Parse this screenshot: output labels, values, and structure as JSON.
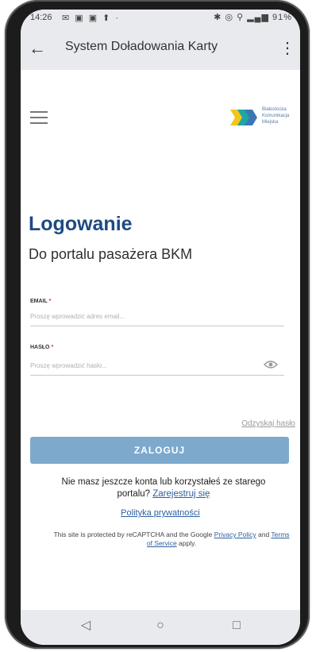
{
  "status_bar": {
    "time": "14:26",
    "left_icons": "✉ ▣ ▣ ⬆ ·",
    "right_icons": "✱ ◎ ⚲ ▂▄▆ 91%"
  },
  "app_bar": {
    "title": "System Doładowania Karty",
    "back_icon": "back-arrow-icon",
    "menu_icon": "kebab-menu-icon"
  },
  "header": {
    "menu_icon": "hamburger-menu-icon",
    "logo_text": [
      "Białostocka",
      "Komunikacja",
      "Miejska"
    ],
    "logo_colors": {
      "yellow": "#f2c51b",
      "blue": "#3c77b5",
      "teal": "#1fa6a4"
    }
  },
  "login": {
    "title": "Logowanie",
    "subtitle": "Do portalu pasażera BKM",
    "email_label": "EMAIL",
    "email_placeholder": "Proszę wprowadzić adres email...",
    "password_label": "HASŁO",
    "password_placeholder": "Proszę wprowadzić hasło...",
    "required_mark": "*",
    "forgot_password": "Odzyskaj hasło",
    "submit": "ZALOGUJ",
    "register_prefix": "Nie masz jeszcze konta lub korzystałeś ze starego portalu?",
    "register_link": "Zarejestruj się",
    "privacy_link": "Polityka prywatności",
    "recaptcha_prefix": "This site is protected by reCAPTCHA and the Google",
    "recaptcha_privacy": "Privacy Policy",
    "recaptcha_and": "and",
    "recaptcha_terms": "Terms of Service",
    "recaptcha_suffix": "apply."
  },
  "nav_bar": {
    "back": "◁",
    "home": "○",
    "recents": "□"
  },
  "colors": {
    "heading": "#1e4a83",
    "button": "#7da9cd",
    "link": "#2d5fa0"
  }
}
